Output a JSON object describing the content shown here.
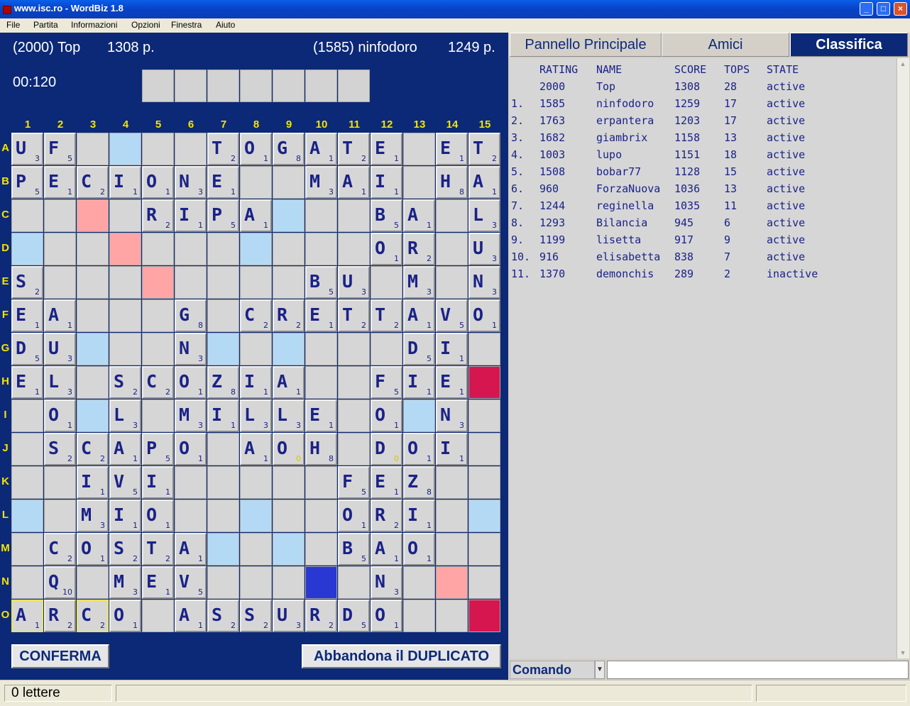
{
  "window": {
    "title": "www.isc.ro - WordBiz 1.8",
    "min_glyph": "_",
    "max_glyph": "□",
    "close_glyph": "×"
  },
  "menu": [
    "File",
    "Partita",
    "Informazioni",
    "Opzioni",
    "Finestra",
    "Aiuto"
  ],
  "game": {
    "player_left": "(2000) Top",
    "score_left": "1308 p.",
    "player_right": "(1585) ninfodoro",
    "score_right": "1249 p.",
    "timer": "00:120",
    "rack": [
      "",
      "",
      "",
      "",
      "",
      "",
      ""
    ],
    "col_labels": [
      "1",
      "2",
      "3",
      "4",
      "5",
      "6",
      "7",
      "8",
      "9",
      "10",
      "11",
      "12",
      "13",
      "14",
      "15"
    ],
    "row_labels": [
      "A",
      "B",
      "C",
      "D",
      "E",
      "F",
      "G",
      "H",
      "I",
      "J",
      "K",
      "L",
      "M",
      "N",
      "O"
    ],
    "board": [
      [
        "U3",
        "F5",
        "",
        "DL",
        "",
        "",
        "T2",
        "O1",
        "G8",
        "A1",
        "T2",
        "E1",
        "",
        "E1",
        "T2"
      ],
      [
        "P5",
        "E1",
        "C2",
        "I1",
        "O1",
        "N3",
        "E1",
        "",
        "",
        "M3",
        "A1",
        "I1",
        "",
        "H8",
        "A1"
      ],
      [
        "",
        "",
        "TL",
        "",
        "R2",
        "I1",
        "P5",
        "A1",
        "DL",
        "",
        "",
        "B5",
        "A1",
        "",
        "L3"
      ],
      [
        "DL",
        "",
        "",
        "TL",
        "",
        "",
        "",
        "DL",
        "",
        "",
        "",
        "O1",
        "R2",
        "",
        "U3"
      ],
      [
        "S2",
        "",
        "",
        "",
        "TL",
        "",
        "",
        "",
        "",
        "B5",
        "U3",
        "",
        "M3",
        "",
        "N3"
      ],
      [
        "E1",
        "A1",
        "",
        "",
        "",
        "G8",
        "",
        "C2",
        "R2",
        "E1",
        "T2",
        "T2",
        "A1",
        "V5",
        "O1"
      ],
      [
        "D5",
        "U3",
        "DL",
        "",
        "",
        "N3",
        "DL",
        "",
        "DL",
        "",
        "",
        "",
        "D5",
        "I1",
        ""
      ],
      [
        "E1",
        "L3",
        "",
        "S2",
        "C2",
        "O1",
        "Z8",
        "I1",
        "A1",
        "",
        "",
        "F5",
        "I1",
        "E1",
        "TW"
      ],
      [
        "",
        "O1",
        "DL",
        "L3",
        "",
        "M3",
        "I1",
        "L3",
        "L3",
        "E1",
        "",
        "O1",
        "DL",
        "N3",
        ""
      ],
      [
        "",
        "S2",
        "C2",
        "A1",
        "P5",
        "O1",
        "",
        "A1",
        "O0",
        "H8",
        "",
        "D0",
        "O1",
        "I1",
        ""
      ],
      [
        "",
        "",
        "I1",
        "V5",
        "I1",
        "",
        "",
        "",
        "",
        "",
        "F5",
        "E1",
        "Z8",
        "",
        ""
      ],
      [
        "DL",
        "",
        "M3",
        "I1",
        "O1",
        "",
        "",
        "DL",
        "",
        "",
        "O1",
        "R2",
        "I1",
        "",
        "DL"
      ],
      [
        "",
        "C2",
        "O1",
        "S2",
        "T2",
        "A1",
        "DL",
        "",
        "DL",
        "",
        "B5",
        "A1",
        "O1",
        "",
        ""
      ],
      [
        "",
        "Q10",
        "",
        "M3",
        "E1",
        "V5",
        "",
        "",
        "",
        "TLB",
        "",
        "N3",
        "",
        "TL",
        ""
      ],
      [
        "A1*",
        "R2",
        "C2*",
        "O1",
        "",
        "A1",
        "S2",
        "S2",
        "U3",
        "R2",
        "D5",
        "O1",
        "",
        "",
        "TW"
      ]
    ],
    "confirm_label": "CONFERMA",
    "abandon_label": "Abbandona il DUPLICATO"
  },
  "panel": {
    "tabs": [
      "Pannello Principale",
      "Amici",
      "Classifica"
    ],
    "active_tab": "Classifica",
    "columns": [
      "RATING",
      "NAME",
      "SCORE",
      "TOPS",
      "STATE"
    ],
    "rows": [
      {
        "rank": "",
        "rating": "2000",
        "name": "Top",
        "score": "1308",
        "tops": "28",
        "state": "active"
      },
      {
        "rank": "1.",
        "rating": "1585",
        "name": "ninfodoro",
        "score": "1259",
        "tops": "17",
        "state": "active"
      },
      {
        "rank": "2.",
        "rating": "1763",
        "name": "erpantera",
        "score": "1203",
        "tops": "17",
        "state": "active"
      },
      {
        "rank": "3.",
        "rating": "1682",
        "name": "giambrix",
        "score": "1158",
        "tops": "13",
        "state": "active"
      },
      {
        "rank": "4.",
        "rating": "1003",
        "name": "lupo",
        "score": "1151",
        "tops": "18",
        "state": "active"
      },
      {
        "rank": "5.",
        "rating": "1508",
        "name": "bobar77",
        "score": "1128",
        "tops": "15",
        "state": "active"
      },
      {
        "rank": "6.",
        "rating": "960",
        "name": "ForzaNuova",
        "score": "1036",
        "tops": "13",
        "state": "active"
      },
      {
        "rank": "7.",
        "rating": "1244",
        "name": "reginella",
        "score": "1035",
        "tops": "11",
        "state": "active"
      },
      {
        "rank": "8.",
        "rating": "1293",
        "name": "Bilancia",
        "score": "945",
        "tops": "6",
        "state": "active"
      },
      {
        "rank": "9.",
        "rating": "1199",
        "name": "lisetta",
        "score": "917",
        "tops": "9",
        "state": "active"
      },
      {
        "rank": "10.",
        "rating": "916",
        "name": "elisabetta",
        "score": "838",
        "tops": "7",
        "state": "active"
      },
      {
        "rank": "11.",
        "rating": "1370",
        "name": "demonchis",
        "score": "289",
        "tops": "2",
        "state": "inactive"
      }
    ],
    "command_label": "Comando",
    "command_value": ""
  },
  "status": {
    "letters": "0 lettere"
  }
}
